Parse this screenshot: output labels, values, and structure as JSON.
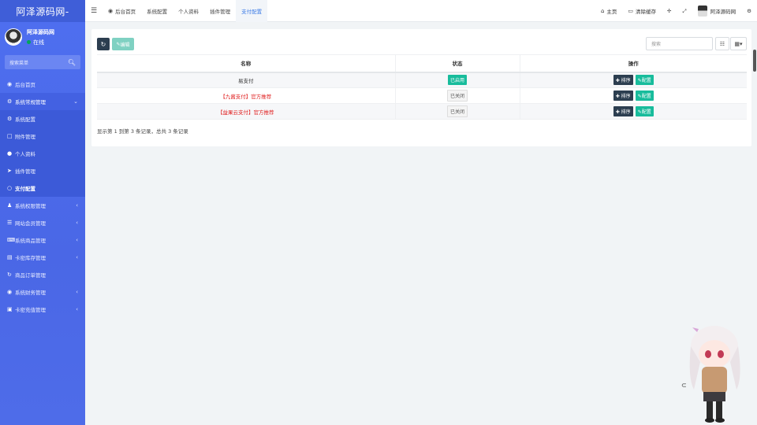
{
  "brand": {
    "title": "阿泽源码网-"
  },
  "user": {
    "name": "阿泽源码网",
    "status": "在线"
  },
  "sidebar": {
    "search_placeholder": "搜索菜单",
    "items": [
      {
        "label": "后台首页",
        "icon": "dashboard-icon"
      },
      {
        "label": "系统常规管理",
        "icon": "cogs-icon",
        "expanded": true
      },
      {
        "label": "系统配置",
        "icon": "gear-icon",
        "sub": true
      },
      {
        "label": "附件管理",
        "icon": "file-icon",
        "sub": true
      },
      {
        "label": "个人资料",
        "icon": "user-icon",
        "sub": true
      },
      {
        "label": "插件管理",
        "icon": "rocket-icon",
        "sub": true
      },
      {
        "label": "支付配置",
        "icon": "circle-icon",
        "sub": true,
        "active": true
      },
      {
        "label": "系统权限管理",
        "icon": "group-icon"
      },
      {
        "label": "网站会员管理",
        "icon": "list-icon"
      },
      {
        "label": "系统商品管理",
        "icon": "keyboard-icon"
      },
      {
        "label": "卡密库存管理",
        "icon": "cart-icon"
      },
      {
        "label": "商品订单管理",
        "icon": "history-icon"
      },
      {
        "label": "系统财务管理",
        "icon": "binoculars-icon"
      },
      {
        "label": "卡密充值管理",
        "icon": "laptop-icon"
      }
    ]
  },
  "topnav": {
    "tabs": [
      {
        "label": "后台首页",
        "icon": "dashboard-icon"
      },
      {
        "label": "系统配置"
      },
      {
        "label": "个人资料"
      },
      {
        "label": "插件管理"
      },
      {
        "label": "支付配置",
        "active": true
      }
    ],
    "home_label": "主页",
    "clear_cache_label": "清除缓存",
    "user_label": "阿泽源码网"
  },
  "toolbar": {
    "edit_label": "编辑",
    "search_placeholder": "搜索"
  },
  "table": {
    "headers": [
      "名称",
      "状态",
      "操作"
    ],
    "rows": [
      {
        "name": "易支付",
        "status": "已启用",
        "enabled": true,
        "highlight": false
      },
      {
        "name": "【九酱支付】官方推荐",
        "status": "已关闭",
        "enabled": false,
        "highlight": true
      },
      {
        "name": "【益果云支付】官方推荐",
        "status": "已关闭",
        "enabled": false,
        "highlight": true
      }
    ],
    "sort_label": "排序",
    "config_label": "配置",
    "summary": "显示第 1 到第 3 条记录，总共 3 条记录"
  },
  "colors": {
    "sidebar": "#4e6ff0",
    "accent": "#18bc9c",
    "dark": "#2c3e50",
    "highlight_text": "#e02020"
  }
}
